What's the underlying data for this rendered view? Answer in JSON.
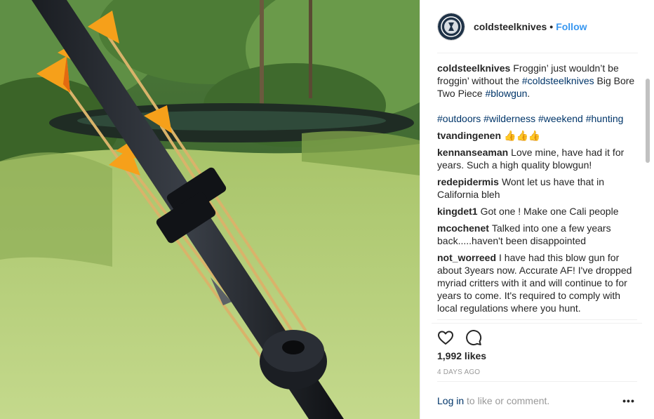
{
  "colors": {
    "accent": "#3897f0",
    "link": "#003569",
    "muted": "#999999",
    "text": "#262626",
    "border": "#efefef"
  },
  "photo": {
    "icon": "photo-of-blowgun-with-darts"
  },
  "header": {
    "username": "coldsteelknives",
    "separator": "•",
    "follow_label": "Follow",
    "avatar_icon": "cold-steel-logo-icon"
  },
  "caption": {
    "username": "coldsteelknives",
    "line1_pre": "Froggin’ just wouldn’t be froggin’ without the ",
    "tag1": "#coldsteelknives",
    "line1_post": " Big Bore Two Piece ",
    "tag2": "#blowgun",
    "line1_end": ".",
    "tag3": "#outdoors",
    "tag4": "#wilderness",
    "tag5": "#weekend",
    "tag6": "#hunting"
  },
  "comments": [
    {
      "user": "tvandingenen",
      "text": "👍👍👍"
    },
    {
      "user": "kennanseaman",
      "text": "Love mine, have had it for years. Such a high quality blowgun!"
    },
    {
      "user": "redepidermis",
      "text": "Wont let us have that in California bleh"
    },
    {
      "user": "kingdet1",
      "text": "Got one ! Make one Cali people"
    },
    {
      "user": "mcochenet",
      "text": "Talked into one a few years back.....haven't been disappointed"
    },
    {
      "user": "not_worreed",
      "text": "I have had this blow gun for about 3years now. Accurate AF! I've dropped myriad critters with it and will continue to for years to come. It's required to comply with local regulations where you hunt."
    }
  ],
  "actions": {
    "like_icon": "heart-icon",
    "comment_icon": "comment-bubble-icon"
  },
  "likes": "1,992 likes",
  "time_ago": "4 DAYS AGO",
  "add_comment": {
    "login": "Log in",
    "rest": " to like or comment.",
    "more_icon": "more-options-icon",
    "more_label": "•••"
  }
}
